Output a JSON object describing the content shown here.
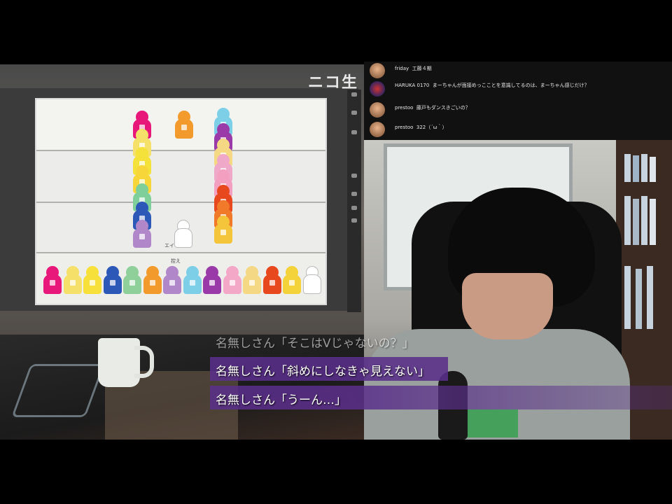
{
  "header": {
    "brand": "ニコ生"
  },
  "comments": [
    {
      "user": "friday",
      "text": "工藤４期"
    },
    {
      "user": "HARUKA 0170",
      "text": "まーちゃんが面接めっこことを意識してるのは、まーちゃん感じだけ？"
    },
    {
      "user": "prestoo",
      "text": "藤戸もダンスきごいの？"
    },
    {
      "user": "prestoo",
      "text": "322（´ω｀）"
    }
  ],
  "slide": {
    "label_unit": "エイ",
    "label_bench": "控え"
  },
  "pieces": {
    "column1": [
      "#e8187a",
      "#f5e16a",
      "#f4e23a",
      "#f7d63a",
      "#7fcf9a",
      "#2c58b8",
      "#b087c9"
    ],
    "column2": [
      "#f29a2c"
    ],
    "column3": [
      "#7dcfe8",
      "#9a3aa8",
      "#f5d884",
      "#f0a8c8",
      "#f3a0c0",
      "#e8481e",
      "#f07a2a",
      "#f4c43a"
    ],
    "bench": [
      "#e8187a",
      "#f5e16a",
      "#f7e03a",
      "#2c58b8",
      "#8fcf9a",
      "#f29a2c",
      "#b087c9",
      "#7dcfe8",
      "#9a3aa8",
      "#f3a8c8",
      "#f5d884",
      "#e8481e",
      "#f4d23a",
      "#ffffff"
    ]
  },
  "overlay_chat": [
    {
      "text": "名無しさん「そこはVじゃないの？」"
    },
    {
      "text": "名無しさん「斜めにしなきゃ見えない」"
    },
    {
      "text": "名無しさん「うーん…」"
    }
  ],
  "colors": {
    "chat_bg": "#5a2f8a",
    "panel_bg": "#111111"
  }
}
